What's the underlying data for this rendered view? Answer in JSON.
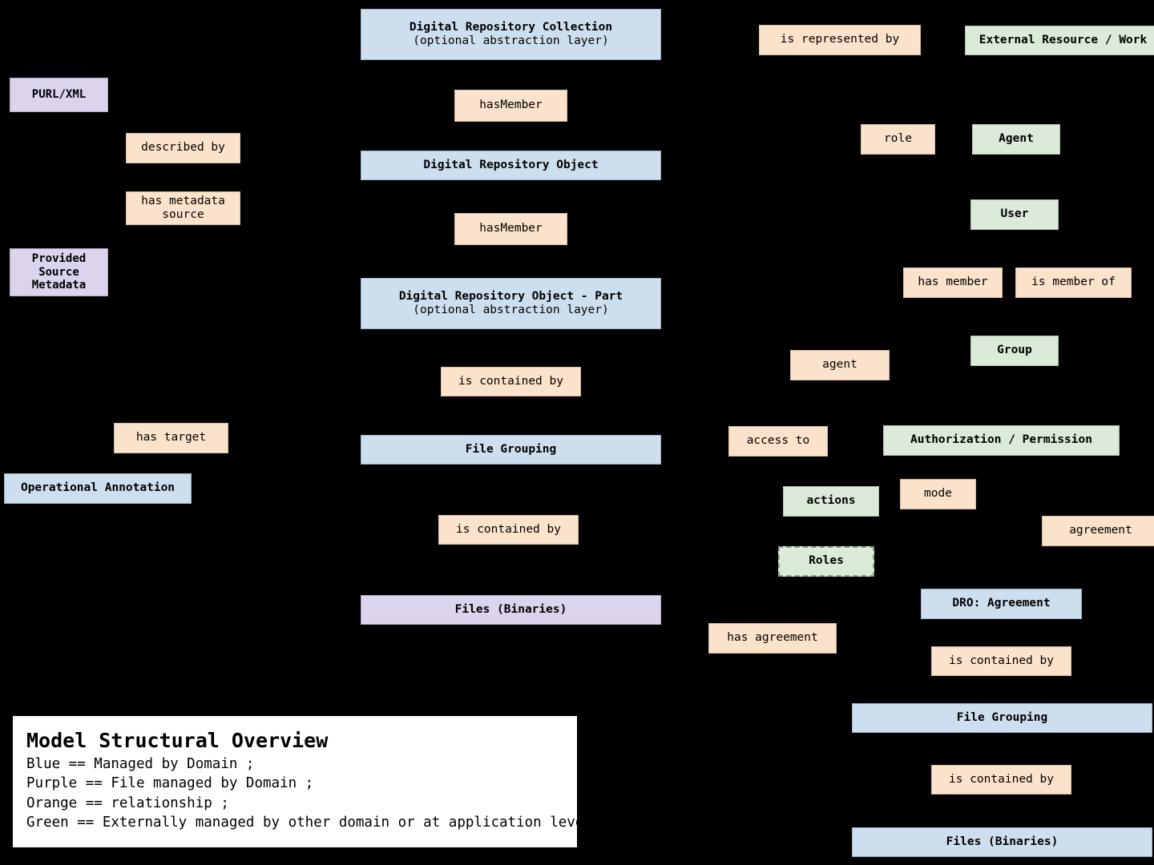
{
  "diagram": {
    "background_color": "#000000",
    "colors": {
      "blue": "#cddfef",
      "purple": "#dcd4ec",
      "orange": "#fbe2ca",
      "green": "#dceada",
      "white": "#ffffff"
    },
    "legend": {
      "title": "Model Structural Overview",
      "lines": [
        "Blue == Managed by Domain ;",
        "Purple == File managed by Domain ;",
        "Orange == relationship ;",
        "Green == Externally managed by other domain or at application level"
      ]
    },
    "nodes": {
      "purl_xml": {
        "label": "PURL/XML",
        "color": "purple"
      },
      "described_by": {
        "label": "described by",
        "color": "orange"
      },
      "has_metadata_source": {
        "label": "has metadata\nsource",
        "color": "orange"
      },
      "provided_source_metadata": {
        "label": "Provided\nSource\nMetadata",
        "color": "purple"
      },
      "has_target": {
        "label": "has target",
        "color": "orange"
      },
      "operational_annotation": {
        "label": "Operational Annotation",
        "color": "blue"
      },
      "digital_repository_collection": {
        "label": "Digital Repository Collection",
        "sublabel": "(optional abstraction layer)",
        "color": "blue"
      },
      "has_member_1": {
        "label": "hasMember",
        "color": "orange"
      },
      "digital_repository_object": {
        "label": "Digital Repository Object",
        "color": "blue"
      },
      "has_member_2": {
        "label": "hasMember",
        "color": "orange"
      },
      "digital_repository_object_part": {
        "label": "Digital Repository Object - Part",
        "sublabel": "(optional abstraction layer)",
        "color": "blue"
      },
      "is_contained_by_center_1": {
        "label": "is contained by",
        "color": "orange"
      },
      "file_grouping_center": {
        "label": "File Grouping",
        "color": "blue"
      },
      "is_contained_by_center_2": {
        "label": "is contained by",
        "color": "orange"
      },
      "files_binaries_center": {
        "label": "Files (Binaries)",
        "color": "purple"
      },
      "is_represented_by": {
        "label": "is represented by",
        "color": "orange"
      },
      "external_resource_work": {
        "label": "External Resource / Work",
        "color": "green"
      },
      "role": {
        "label": "role",
        "color": "orange"
      },
      "agent_entity": {
        "label": "Agent",
        "color": "green"
      },
      "user": {
        "label": "User",
        "color": "green"
      },
      "has_member_right": {
        "label": "has member",
        "color": "orange"
      },
      "is_member_of": {
        "label": "is member of",
        "color": "orange"
      },
      "group": {
        "label": "Group",
        "color": "green"
      },
      "agent_rel": {
        "label": "agent",
        "color": "orange"
      },
      "access_to": {
        "label": "access to",
        "color": "orange"
      },
      "authorization_permission": {
        "label": "Authorization / Permission",
        "color": "green"
      },
      "actions": {
        "label": "actions",
        "color": "green"
      },
      "mode": {
        "label": "mode",
        "color": "orange"
      },
      "agreement": {
        "label": "agreement",
        "color": "orange"
      },
      "roles": {
        "label": "Roles",
        "color": "green",
        "border": "dashed"
      },
      "has_agreement": {
        "label": "has agreement",
        "color": "orange"
      },
      "dro_agreement": {
        "label": "DRO: Agreement",
        "color": "blue"
      },
      "is_contained_by_right_1": {
        "label": "is contained by",
        "color": "orange"
      },
      "file_grouping_right": {
        "label": "File Grouping",
        "color": "blue"
      },
      "is_contained_by_right_2": {
        "label": "is contained by",
        "color": "orange"
      },
      "files_binaries_right": {
        "label": "Files (Binaries)",
        "color": "blue"
      }
    }
  }
}
